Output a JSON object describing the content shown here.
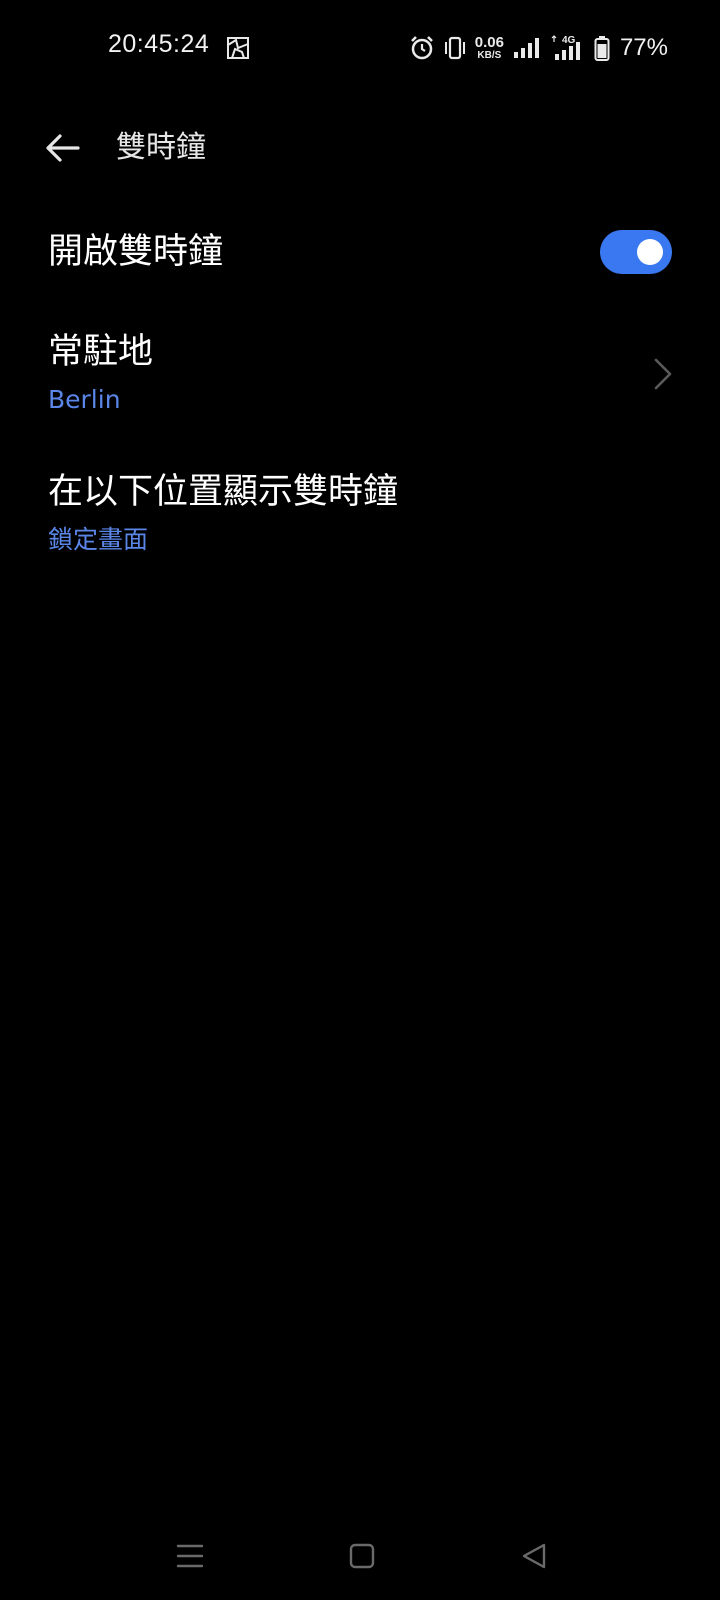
{
  "status_bar": {
    "time": "20:45:24",
    "notification_icon": "gallery-icon",
    "net_speed_value": "0.06",
    "net_speed_unit": "KB/S",
    "network_type": "4G",
    "battery_percent": "77%"
  },
  "header": {
    "title": "雙時鐘",
    "back_icon": "arrow-left-icon"
  },
  "settings": {
    "enable": {
      "title": "開啟雙時鐘",
      "enabled": true
    },
    "home_location": {
      "title": "常駐地",
      "value": "Berlin"
    },
    "display_location": {
      "title": "在以下位置顯示雙時鐘",
      "value": "鎖定畫面"
    }
  },
  "nav_bar": {
    "menu_icon": "menu-icon",
    "home_icon": "home-square-icon",
    "back_icon": "back-triangle-icon"
  },
  "colors": {
    "background": "#000000",
    "accent": "#3a78f2",
    "subtext": "#5a86e8"
  }
}
